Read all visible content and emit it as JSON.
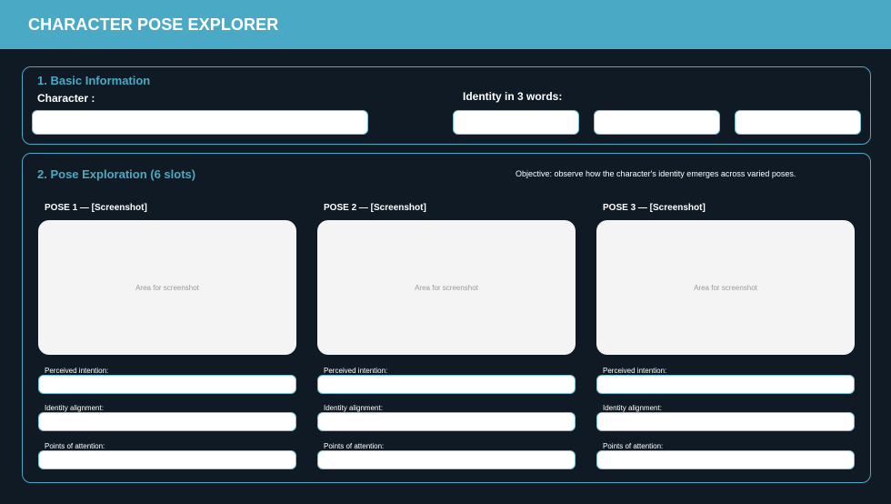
{
  "header": {
    "title": "CHARACTER POSE EXPLORER"
  },
  "basic": {
    "title": "1. Basic Information",
    "character_label": "Character :",
    "identity_label": "Identity in 3 words:",
    "character_value": "",
    "identity_words": [
      "",
      "",
      ""
    ]
  },
  "poses_section": {
    "title": "2. Pose Exploration (6 slots)",
    "objective": "Objective: observe how the character's identity emerges across varied poses.",
    "placeholder": "Area for screenshot",
    "field_labels": [
      "Perceived intention:",
      "Identity alignment:",
      "Points of attention:"
    ],
    "poses": [
      {
        "title": "POSE 1 — [Screenshot]"
      },
      {
        "title": "POSE 2 — [Screenshot]"
      },
      {
        "title": "POSE 3 — [Screenshot]"
      }
    ]
  },
  "colors": {
    "accent": "#4aa9c4",
    "background": "#101a24",
    "field_border": "#7cc3d8"
  }
}
